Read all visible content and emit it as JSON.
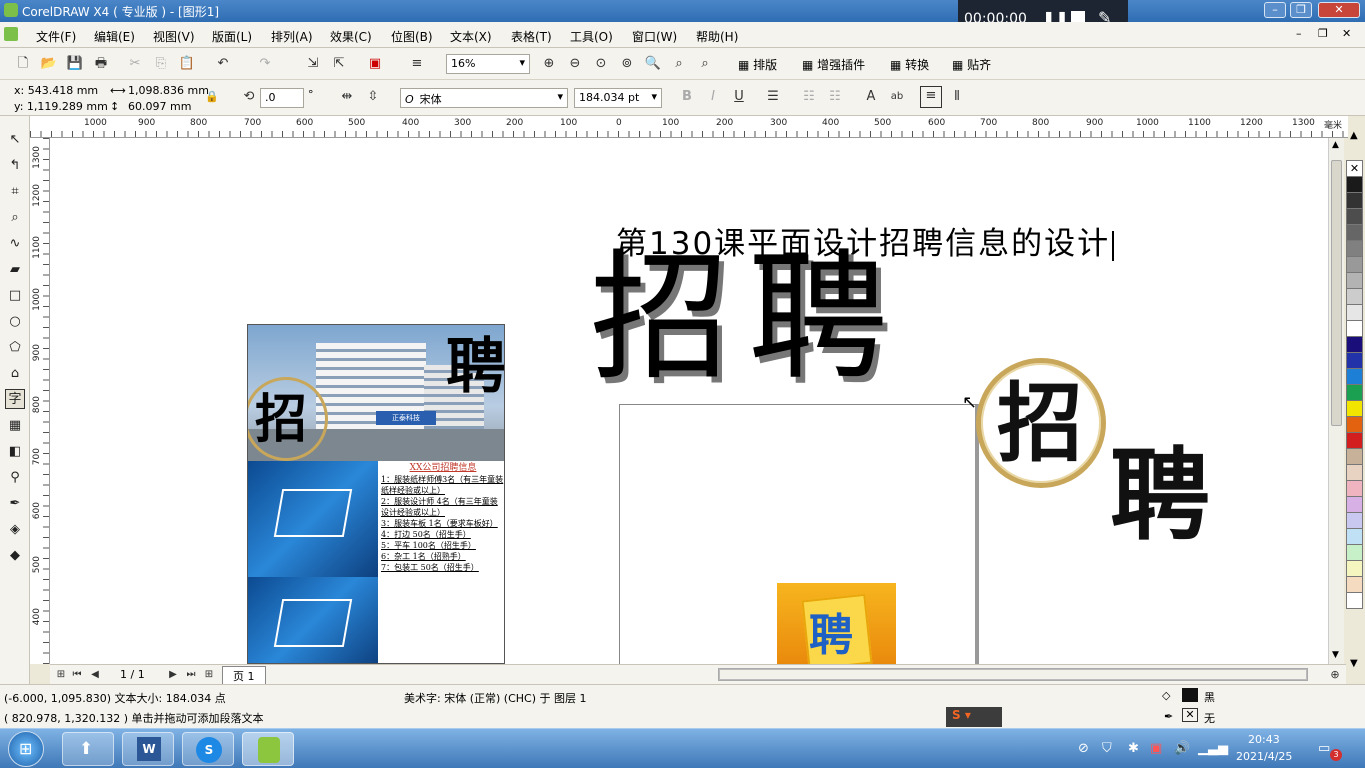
{
  "window": {
    "title": "CorelDRAW X4 ( 专业版 ) - [图形1]"
  },
  "recorder": {
    "time": "00:00:00"
  },
  "menu": [
    "文件(F)",
    "编辑(E)",
    "视图(V)",
    "版面(L)",
    "排列(A)",
    "效果(C)",
    "位图(B)",
    "文本(X)",
    "表格(T)",
    "工具(O)",
    "窗口(W)",
    "帮助(H)"
  ],
  "toolbar": {
    "zoom": "16%",
    "layout_btn": "排版",
    "plugin_btn": "增强插件",
    "convert_btn": "转换",
    "snap_btn": "贴齐"
  },
  "propbar": {
    "x": "x: 543.418 mm",
    "y": "y: 1,119.289 mm",
    "width": "1,098.836 mm",
    "height": "60.097 mm",
    "angle": ".0",
    "degree_unit": "°",
    "font": "宋体",
    "font_size": "184.034 pt"
  },
  "ruler": {
    "h_labels": [
      "1000",
      "900",
      "800",
      "700",
      "600",
      "500",
      "400",
      "300",
      "200",
      "100",
      "0",
      "100",
      "200",
      "300",
      "400",
      "500",
      "600",
      "700",
      "800",
      "900",
      "1000",
      "1100",
      "1200",
      "1300"
    ],
    "h_unit": "毫米",
    "v_labels": [
      "1300",
      "1200",
      "1100",
      "1000",
      "900",
      "800",
      "700",
      "600",
      "500",
      "400"
    ]
  },
  "canvas": {
    "heading": "第130课平面设计招聘信息的设计",
    "big_title": "招聘",
    "ring_char": "招",
    "side_char": "聘",
    "poster": {
      "char_top": "聘",
      "char_ring": "招",
      "building_sign": "正泰科技",
      "info_title": "XX公司招聘信息",
      "info_lines": [
        "1：服装纸样师傅3名（有三年童装纸样经验或以上）",
        "2：服装设计师  4名（有三年童装设计经验或以上）",
        "3：服装车板    1名（要求车板好）",
        "4：打边      50名（招生手）",
        "5：平车      100名（招生手）",
        "6：杂工      1名（招熟手）",
        "7：包装工    50名（招生手）"
      ]
    },
    "sticker_char": "聘"
  },
  "pagebar": {
    "page_count": "1 / 1",
    "page_tab": "页 1"
  },
  "status": {
    "line1": "(-6.000, 1,095.830)  文本大小: 184.034 点",
    "line2": "( 820.978, 1,320.132 ) 单击并拖动可添加段落文本",
    "object_info": "美术字: 宋体 (正常) (CHC) 于 图层 1",
    "fill_label": "黑",
    "outline_label": "无"
  },
  "taskbar": {
    "time": "20:43",
    "date": "2021/4/25",
    "notify_count": "3"
  },
  "colors": {
    "accent": "#2f6db3",
    "poster_blue": "#1565b8",
    "ring_gold": "#c9a75a",
    "info_title": "#c0392b"
  },
  "palette": [
    "#ffffff",
    "#1a1a1a",
    "#333333",
    "#4d4d4d",
    "#666666",
    "#808080",
    "#999999",
    "#b3b3b3",
    "#cccccc",
    "#e6e6e6",
    "#ffffff",
    "#1a0f7a",
    "#2233aa",
    "#1e7fd6",
    "#1aa050",
    "#f2e600",
    "#e3620f",
    "#d21e1e",
    "#c7b299",
    "#e8d2c2",
    "#f0b3c0",
    "#d7b0e6",
    "#c8c8f0",
    "#bfe0f5",
    "#c8f0c8",
    "#f5f5c0",
    "#f5dcc0",
    "#ffffff"
  ]
}
